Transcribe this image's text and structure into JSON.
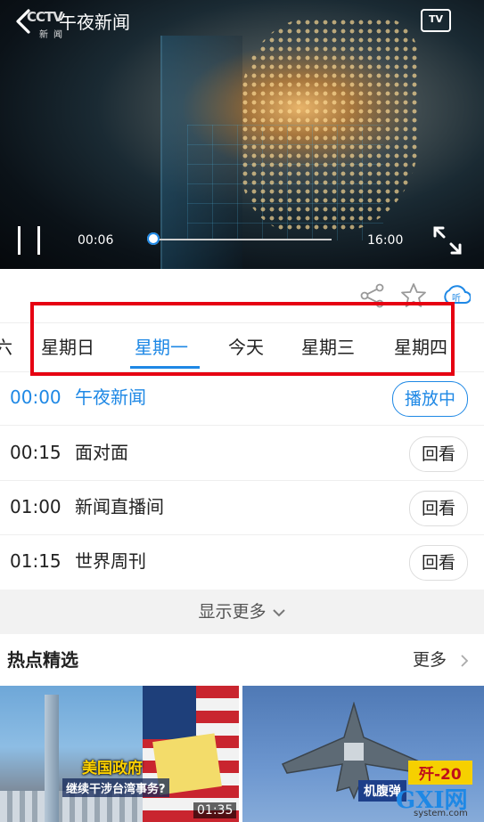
{
  "player": {
    "title": "午夜新闻",
    "logo_text": "CCTV",
    "logo_sub": "新闻",
    "tv_label": "TV",
    "time_current": "00:06",
    "time_total": "16:00",
    "progress": 0.006
  },
  "actions": [
    "share-icon",
    "star-icon",
    "listen-icon"
  ],
  "tabs": {
    "items": [
      "六",
      "星期日",
      "星期一",
      "今天",
      "星期三",
      "星期四"
    ],
    "active_index": 2
  },
  "schedule": [
    {
      "time": "00:00",
      "name": "午夜新闻",
      "action": "播放中",
      "live": true
    },
    {
      "time": "00:15",
      "name": "面对面",
      "action": "回看",
      "live": false
    },
    {
      "time": "01:00",
      "name": "新闻直播间",
      "action": "回看",
      "live": false
    },
    {
      "time": "01:15",
      "name": "世界周刊",
      "action": "回看",
      "live": false
    }
  ],
  "show_more": "显示更多",
  "hot": {
    "heading": "热点精选",
    "more": "更多",
    "cards": [
      {
        "caption_main": "美国政府",
        "caption_sub": "继续干涉台湾事务?",
        "duration": "01:35"
      },
      {
        "caption_main": "歼-20",
        "caption_sub": "机腹弹"
      }
    ]
  },
  "watermark": {
    "brand": "GXI网",
    "domain": "system.com"
  },
  "colors": {
    "accent": "#1e88e5",
    "highlight_box": "#e60012"
  }
}
